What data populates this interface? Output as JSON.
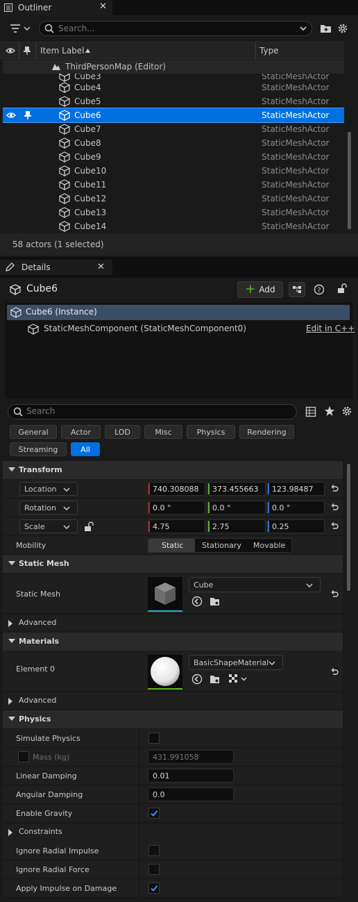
{
  "outliner": {
    "tab_title": "Outliner",
    "search_placeholder": "Search...",
    "col_item_label": "Item Label",
    "col_type": "Type",
    "map_label": "ThirdPersonMap (Editor)",
    "partial_row": {
      "name": "Cube3",
      "type": "StaticMeshActor"
    },
    "rows": [
      {
        "name": "Cube4",
        "type": "StaticMeshActor"
      },
      {
        "name": "Cube5",
        "type": "StaticMeshActor"
      },
      {
        "name": "Cube6",
        "type": "StaticMeshActor"
      },
      {
        "name": "Cube7",
        "type": "StaticMeshActor"
      },
      {
        "name": "Cube8",
        "type": "StaticMeshActor"
      },
      {
        "name": "Cube9",
        "type": "StaticMeshActor"
      },
      {
        "name": "Cube10",
        "type": "StaticMeshActor"
      },
      {
        "name": "Cube11",
        "type": "StaticMeshActor"
      },
      {
        "name": "Cube12",
        "type": "StaticMeshActor"
      },
      {
        "name": "Cube13",
        "type": "StaticMeshActor"
      },
      {
        "name": "Cube14",
        "type": "StaticMeshActor"
      }
    ],
    "status": "58 actors (1 selected)"
  },
  "details": {
    "tab_title": "Details",
    "actor_name": "Cube6",
    "add_label": "Add",
    "instance_label": "Cube6 (Instance)",
    "component_label": "StaticMeshComponent (StaticMeshComponent0)",
    "edit_cpp": "Edit in C++",
    "search_placeholder": "Search",
    "filters": [
      "General",
      "Actor",
      "LOD",
      "Misc",
      "Physics",
      "Rendering",
      "Streaming",
      "All"
    ],
    "active_filter": "All",
    "transform": {
      "title": "Transform",
      "location": {
        "label": "Location",
        "x": "740.308088",
        "y": "373.455663",
        "z": "123.98487"
      },
      "rotation": {
        "label": "Rotation",
        "x": "0.0 °",
        "y": "0.0 °",
        "z": "0.0 °"
      },
      "scale": {
        "label": "Scale",
        "x": "4.75",
        "y": "2.75",
        "z": "0.25"
      },
      "mobility_label": "Mobility",
      "mobility_options": [
        "Static",
        "Stationary",
        "Movable"
      ],
      "mobility_selected": "Static"
    },
    "static_mesh": {
      "title": "Static Mesh",
      "label": "Static Mesh",
      "value": "Cube",
      "advanced": "Advanced"
    },
    "materials": {
      "title": "Materials",
      "element_label": "Element 0",
      "value": "BasicShapeMaterial",
      "advanced": "Advanced"
    },
    "physics": {
      "title": "Physics",
      "simulate_physics": {
        "label": "Simulate Physics",
        "checked": false
      },
      "mass": {
        "label": "Mass (kg)",
        "value": "431.991058"
      },
      "linear_damping": {
        "label": "Linear Damping",
        "value": "0.01"
      },
      "angular_damping": {
        "label": "Angular Damping",
        "value": "0.0"
      },
      "enable_gravity": {
        "label": "Enable Gravity",
        "checked": true
      },
      "constraints": "Constraints",
      "ignore_radial_impulse": {
        "label": "Ignore Radial Impulse",
        "checked": false
      },
      "ignore_radial_force": {
        "label": "Ignore Radial Force",
        "checked": false
      },
      "apply_impulse_on_damage": {
        "label": "Apply Impulse on Damage",
        "checked": true
      }
    }
  },
  "colors": {
    "accent": "#0070e0",
    "x_axis": "#c4261c",
    "y_axis": "#5fb51e",
    "z_axis": "#2d6fd8",
    "add_plus": "#4fbf26"
  }
}
